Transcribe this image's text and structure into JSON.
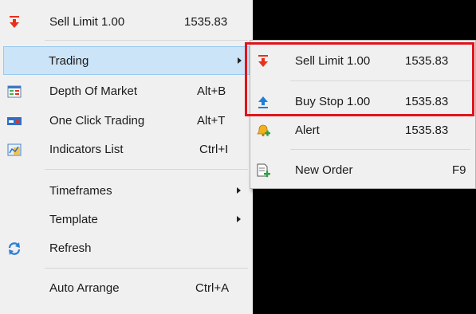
{
  "main_menu": {
    "items": [
      {
        "label": "Sell Limit 1.00",
        "value": "1535.83"
      },
      {
        "label": "Trading"
      },
      {
        "label": "Depth Of Market",
        "shortcut": "Alt+B"
      },
      {
        "label": "One Click Trading",
        "shortcut": "Alt+T"
      },
      {
        "label": "Indicators List",
        "shortcut": "Ctrl+I"
      },
      {
        "label": "Timeframes"
      },
      {
        "label": "Template"
      },
      {
        "label": "Refresh"
      },
      {
        "label": "Auto Arrange",
        "shortcut": "Ctrl+A"
      }
    ]
  },
  "sub_menu": {
    "items": [
      {
        "label": "Sell Limit 1.00",
        "value": "1535.83"
      },
      {
        "label": "Buy Stop 1.00",
        "value": "1535.83"
      },
      {
        "label": "Alert",
        "value": "1535.83"
      },
      {
        "label": "New Order",
        "shortcut": "F9"
      }
    ]
  },
  "icons": {
    "sell": "sell-arrow-icon",
    "buy": "buy-arrow-icon",
    "depth": "depth-of-market-icon",
    "one_click": "one-click-trading-icon",
    "indicators": "indicators-list-icon",
    "refresh": "refresh-icon",
    "alert": "alert-bell-icon",
    "new_order": "new-order-icon"
  },
  "colors": {
    "highlight": "#cce4f7",
    "annotation": "#e0141c",
    "sell": "#e8301a",
    "buy": "#1f7fd8"
  }
}
